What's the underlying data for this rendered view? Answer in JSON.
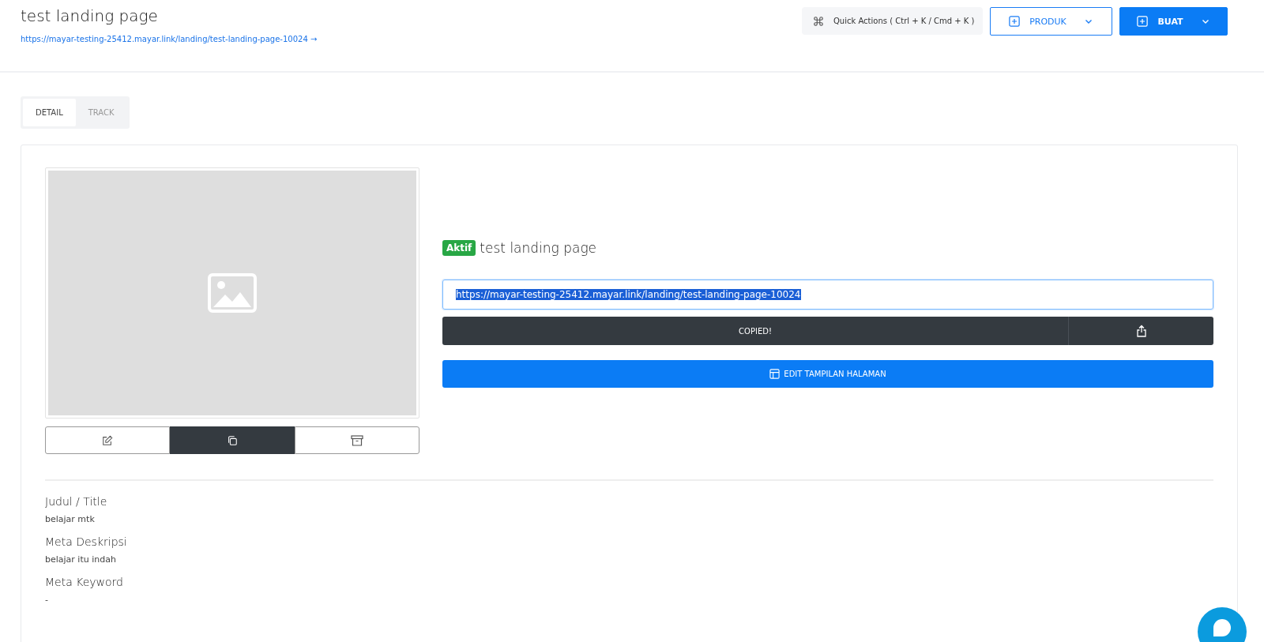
{
  "header": {
    "title": "test landing page",
    "link": "https://mayar-testing-25412.mayar.link/landing/test-landing-page-10024 →",
    "quick_actions": "Quick Actions ( Ctrl + K / Cmd + K )",
    "buttons": [
      {
        "label": "PRODUK",
        "kind": "outline"
      },
      {
        "label": "BUAT",
        "kind": "primary"
      }
    ]
  },
  "tabs": [
    {
      "label": "DETAIL",
      "selected": true
    },
    {
      "label": "TRACK",
      "selected": false
    }
  ],
  "preview": {
    "kind": "placeholder",
    "actions": [
      {
        "kind": "edit",
        "selected": false
      },
      {
        "kind": "duplicate",
        "selected": true
      },
      {
        "kind": "archive",
        "selected": false
      }
    ]
  },
  "page": {
    "status": "Aktif",
    "title": "test landing page",
    "url": {
      "value": "https://mayar-testing-25412.mayar.link/landing/test-landing-page-10024",
      "selected": true
    },
    "copy_button": "COPIED!",
    "edit_button": "EDIT TAMPILAN HALAMAN"
  },
  "fields": [
    {
      "label": "Judul / Title",
      "value": "belajar mtk"
    },
    {
      "label": "Meta Deskripsi",
      "value": "belajar itu indah"
    },
    {
      "label": "Meta Keyword",
      "value": "-"
    }
  ]
}
